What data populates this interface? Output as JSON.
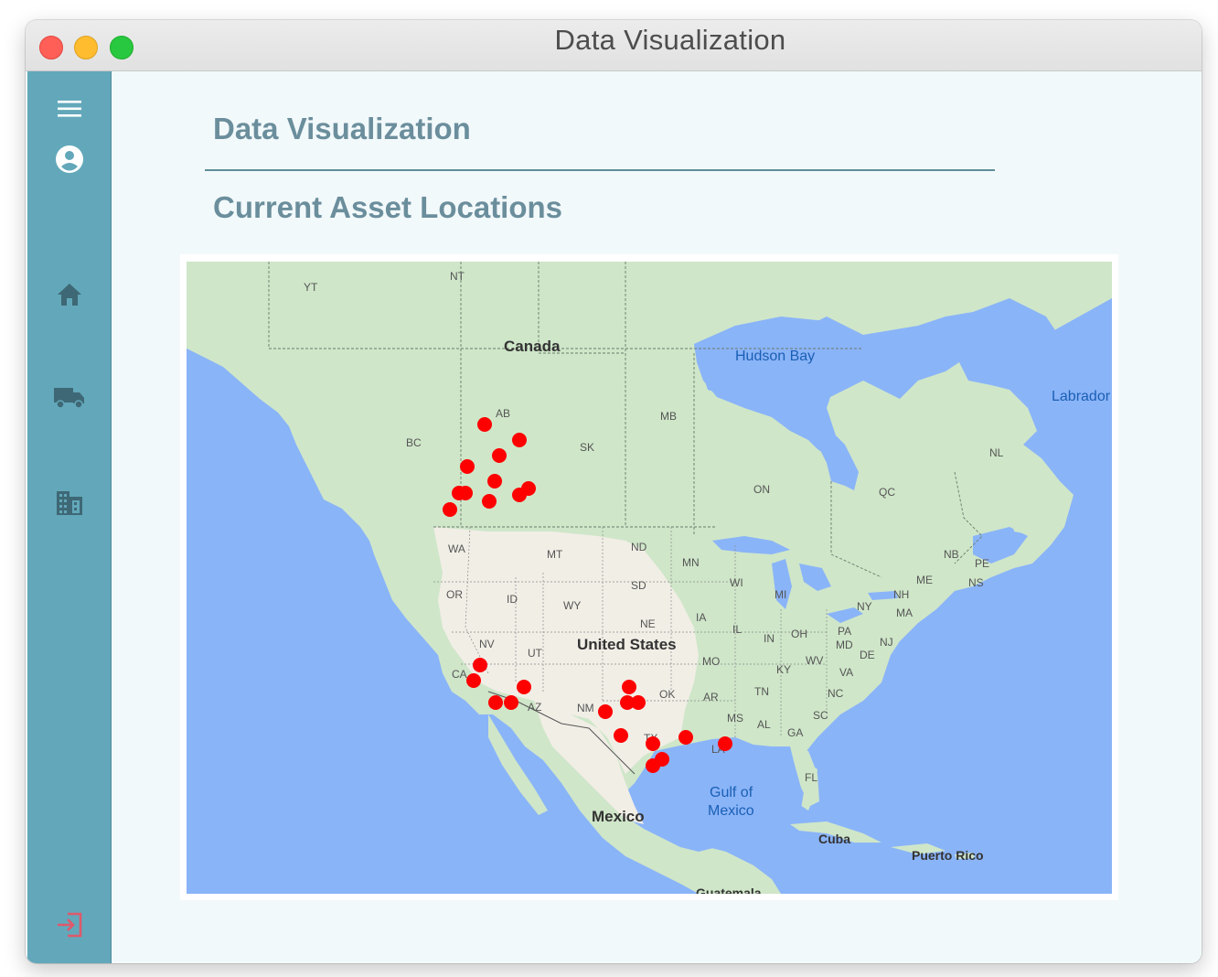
{
  "window": {
    "title": "Data Visualization"
  },
  "sidebar": {
    "items": [
      {
        "name": "menu-icon"
      },
      {
        "name": "account-icon"
      },
      {
        "name": "home-icon"
      },
      {
        "name": "truck-icon"
      },
      {
        "name": "building-icon"
      },
      {
        "name": "logout-icon"
      }
    ]
  },
  "main": {
    "title": "Data Visualization",
    "subtitle": "Current Asset Locations"
  },
  "map": {
    "country_labels": [
      "Canada",
      "United States",
      "Mexico"
    ],
    "water_labels": [
      "Hudson Bay",
      "Labrador",
      "Gulf of",
      "Mexico"
    ],
    "other_labels": [
      "Cuba",
      "Puerto Rico",
      "Guatemala"
    ],
    "region_labels": [
      "NT",
      "YT",
      "AB",
      "MB",
      "BC",
      "SK",
      "ON",
      "QC",
      "NL",
      "NB",
      "PE",
      "NS",
      "ME",
      "NH",
      "MA",
      "NY",
      "WA",
      "MT",
      "ND",
      "MN",
      "SD",
      "WI",
      "MI",
      "OR",
      "ID",
      "WY",
      "IA",
      "NE",
      "IL",
      "IN",
      "OH",
      "PA",
      "MD",
      "DE",
      "NJ",
      "NV",
      "UT",
      "CA",
      "MO",
      "KY",
      "WV",
      "VA",
      "AZ",
      "NM",
      "OK",
      "AR",
      "TN",
      "NC",
      "SC",
      "MS",
      "AL",
      "GA",
      "TX",
      "LA",
      "FL"
    ],
    "colors": {
      "water": "#8ab4f8",
      "land": "#d4e8cf",
      "us_land": "#f2efe7",
      "marker": "#ff0000"
    }
  }
}
